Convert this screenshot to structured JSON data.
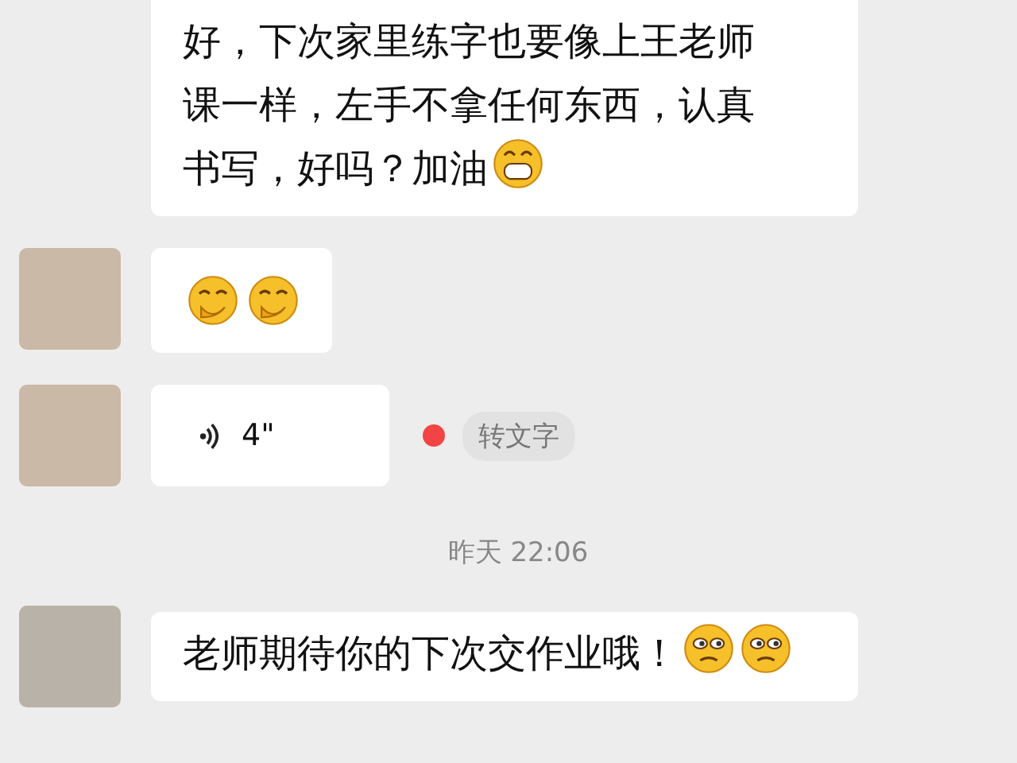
{
  "messages": [
    {
      "kind": "text",
      "lines": [
        "好，下次家里练字也要像上王老师",
        "课一样，左手不拿任何东西，认真",
        "书写，好吗？加油"
      ],
      "emojis": [
        {
          "kind": "grin"
        }
      ]
    },
    {
      "kind": "emoji",
      "avatar": {
        "kind": "person"
      },
      "emojis": [
        {
          "kind": "shy"
        },
        {
          "kind": "shy"
        }
      ]
    },
    {
      "kind": "voice",
      "avatar": {
        "kind": "person"
      },
      "duration": "4\"",
      "unread": true,
      "convert_button": "转文字"
    },
    {
      "kind": "time",
      "text": "昨天 22:06"
    },
    {
      "kind": "text",
      "avatar": {
        "kind": "logo"
      },
      "text": "老师期待你的下次交作业哦！",
      "emojis": [
        {
          "kind": "smirk"
        },
        {
          "kind": "smirk"
        }
      ]
    }
  ]
}
